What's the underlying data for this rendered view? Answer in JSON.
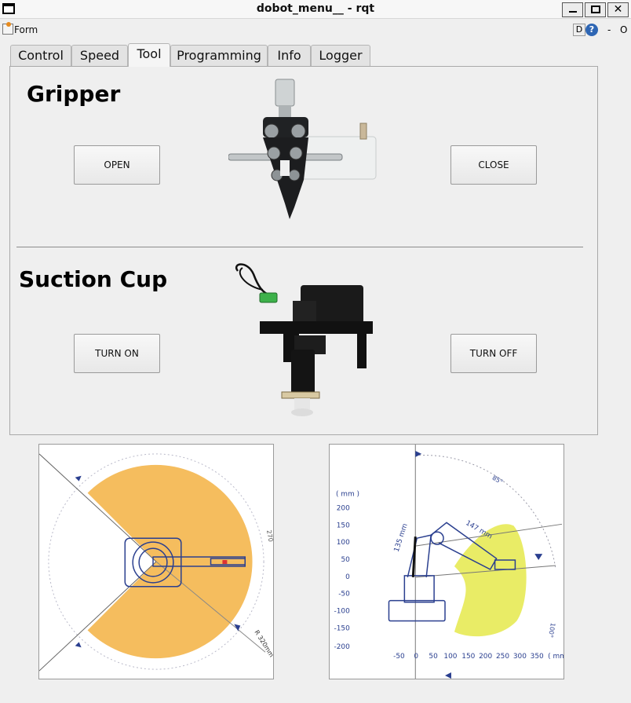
{
  "window": {
    "title": "dobot_menu__ - rqt",
    "minimize_label": "",
    "maximize_label": "",
    "close_label": "✕"
  },
  "plugin_bar": {
    "form_label": "Form",
    "d_label": "D",
    "help_label": "?",
    "dash_label": "-",
    "o_label": "O"
  },
  "tabs": [
    {
      "label": "Control"
    },
    {
      "label": "Speed"
    },
    {
      "label": "Tool",
      "active": true
    },
    {
      "label": "Programming"
    },
    {
      "label": "Info"
    },
    {
      "label": "Logger"
    }
  ],
  "gripper": {
    "title": "Gripper",
    "open_label": "OPEN",
    "close_label": "CLOSE"
  },
  "suction": {
    "title": "Suction Cup",
    "on_label": "TURN ON",
    "off_label": "TURN OFF"
  },
  "workspace_top": {
    "angle_label": "270",
    "radius_label": "R 320mm"
  },
  "workspace_side": {
    "unit_label": "( mm )",
    "y_ticks": [
      "200",
      "150",
      "100",
      "50",
      "0",
      "-50",
      "-100",
      "-150",
      "-200"
    ],
    "x_ticks": [
      "-50",
      "0",
      "50",
      "100",
      "150",
      "200",
      "250",
      "300",
      "350"
    ],
    "x_unit": "( mm",
    "arm1_label": "135 mm",
    "arm2_label": "147 mm",
    "angle_top": "85°",
    "angle_right": "100°"
  },
  "colors": {
    "workspace_orange": "#f5bd5e",
    "workspace_yellow": "#e9ec66",
    "diagram_blue": "#2a3f8f"
  }
}
